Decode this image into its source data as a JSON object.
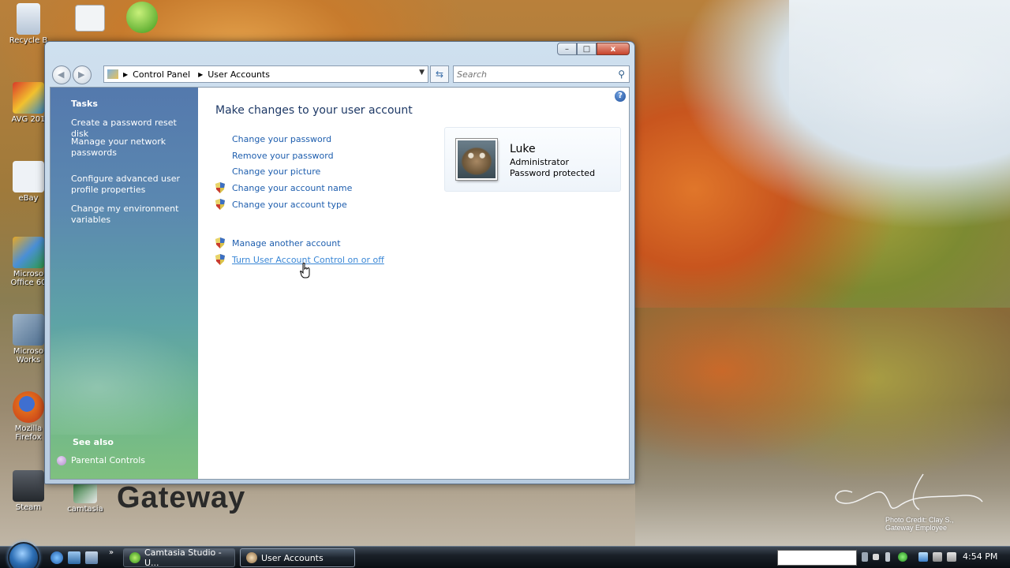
{
  "desktop": {
    "icons": [
      {
        "label": "Recycle B",
        "color": "#c8d6e6"
      },
      {
        "label": "AVG 201",
        "color": "#d93a2a"
      },
      {
        "label": "eBay",
        "color": "#e9eef4"
      },
      {
        "label": "Microso Office 60",
        "color": "#e8a825"
      },
      {
        "label": "Microso Works",
        "color": "#6f8fb0"
      },
      {
        "label": "Mozilla Firefox",
        "color": "#e06a1c"
      },
      {
        "label": "Steam",
        "color": "#3b3f45"
      },
      {
        "label": "camtasia",
        "color": "#2f7a3a"
      }
    ],
    "brand_logo": "Gateway",
    "photo_credit_line1": "Photo Credit: Clay S.,",
    "photo_credit_line2": "Gateway Employee"
  },
  "window": {
    "title": "User Accounts",
    "breadcrumb": [
      "Control Panel",
      "User Accounts"
    ],
    "search_placeholder": "Search",
    "controls": {
      "minimize": "–",
      "maximize": "□",
      "close": "x"
    }
  },
  "sidebar": {
    "heading": "Tasks",
    "items": [
      "Create a password reset disk",
      "Manage your network passwords",
      "Configure advanced user profile properties",
      "Change my environment variables"
    ],
    "see_also_heading": "See also",
    "see_also_items": [
      "Parental Controls"
    ]
  },
  "main": {
    "title": "Make changes to your user account",
    "actions": [
      {
        "label": "Change your password",
        "shield": false
      },
      {
        "label": "Remove your password",
        "shield": false
      },
      {
        "label": "Change your picture",
        "shield": false
      },
      {
        "label": "Change your account name",
        "shield": true
      },
      {
        "label": "Change your account type",
        "shield": true
      },
      {
        "label": "Manage another account",
        "shield": true
      },
      {
        "label": "Turn User Account Control on or off",
        "shield": true,
        "hovered": true
      }
    ],
    "account": {
      "name": "Luke",
      "role": "Administrator",
      "status": "Password protected"
    }
  },
  "taskbar": {
    "buttons": [
      {
        "label": "Camtasia Studio - U...",
        "active": false
      },
      {
        "label": "User Accounts",
        "active": true
      }
    ],
    "clock": "4:54 PM",
    "overflow": "»"
  },
  "colors": {
    "link": "#1e5eae",
    "link_hover": "#3a87d6",
    "title": "#1e3966"
  }
}
